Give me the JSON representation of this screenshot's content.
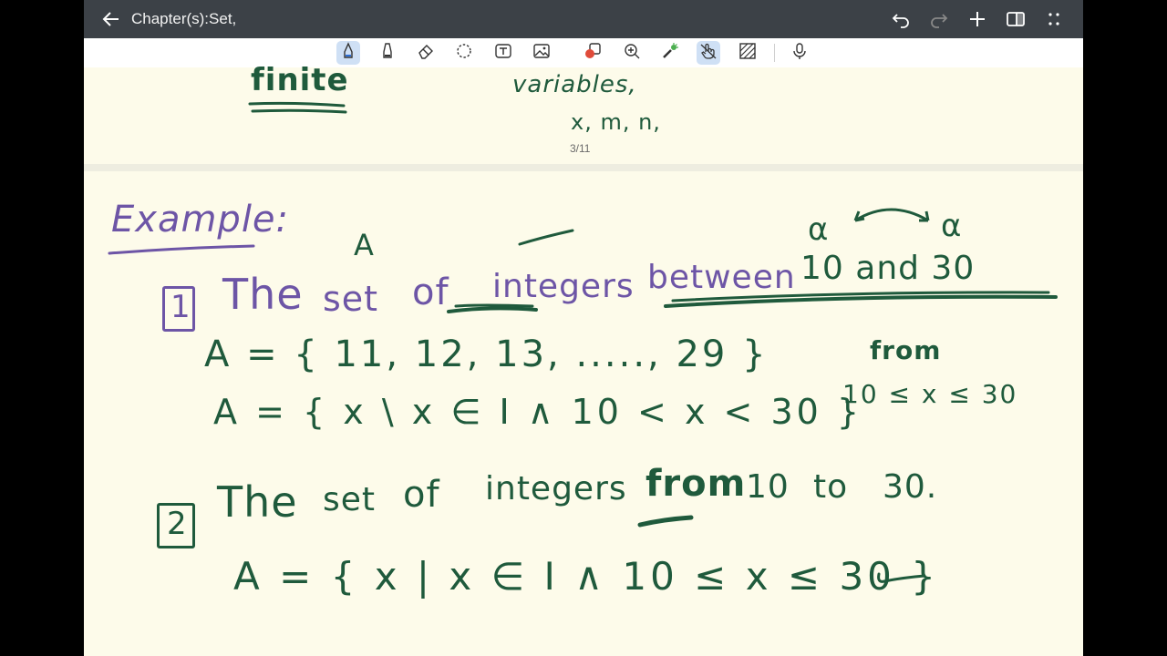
{
  "header": {
    "title": "Chapter(s):Set,"
  },
  "page_indicator": "3/11",
  "toolbar": {
    "tools": [
      "pen-icon",
      "highlighter-icon",
      "eraser-icon",
      "lasso-icon",
      "text-box-icon",
      "image-icon",
      "shapes-icon",
      "zoom-icon",
      "laser-pointer-icon",
      "hand-touch-icon",
      "pattern-icon",
      "microphone-icon"
    ]
  },
  "prev_page": {
    "word1": "finite",
    "word2": "variables,",
    "word3": "x, m, n,"
  },
  "notes": {
    "heading": "Example:",
    "label_A": "A",
    "alpha": "α",
    "item1_num": "1",
    "item1_text": [
      "The",
      "set",
      "of",
      "integers",
      "between",
      "10 and 30"
    ],
    "item1_roster": "A = { 11, 12, 13, ....., 29 }",
    "item1_builder": "A = { x \\ x ∈ I  ∧  10 < x < 30 }",
    "side_from": "from",
    "side_ineq": "10 ≤ x ≤ 30",
    "item2_num": "2",
    "item2_text": [
      "The",
      "set",
      "of",
      "integers",
      "from",
      "10",
      "to",
      "30."
    ],
    "item2_builder": "A = { x | x ∈ I  ∧  10 ≤ x ≤ 30 }"
  },
  "colors": {
    "ink_green": "#1f5a3c",
    "ink_purple": "#6d55a6",
    "paper": "#fdfbea",
    "titlebar": "#3c4147"
  }
}
